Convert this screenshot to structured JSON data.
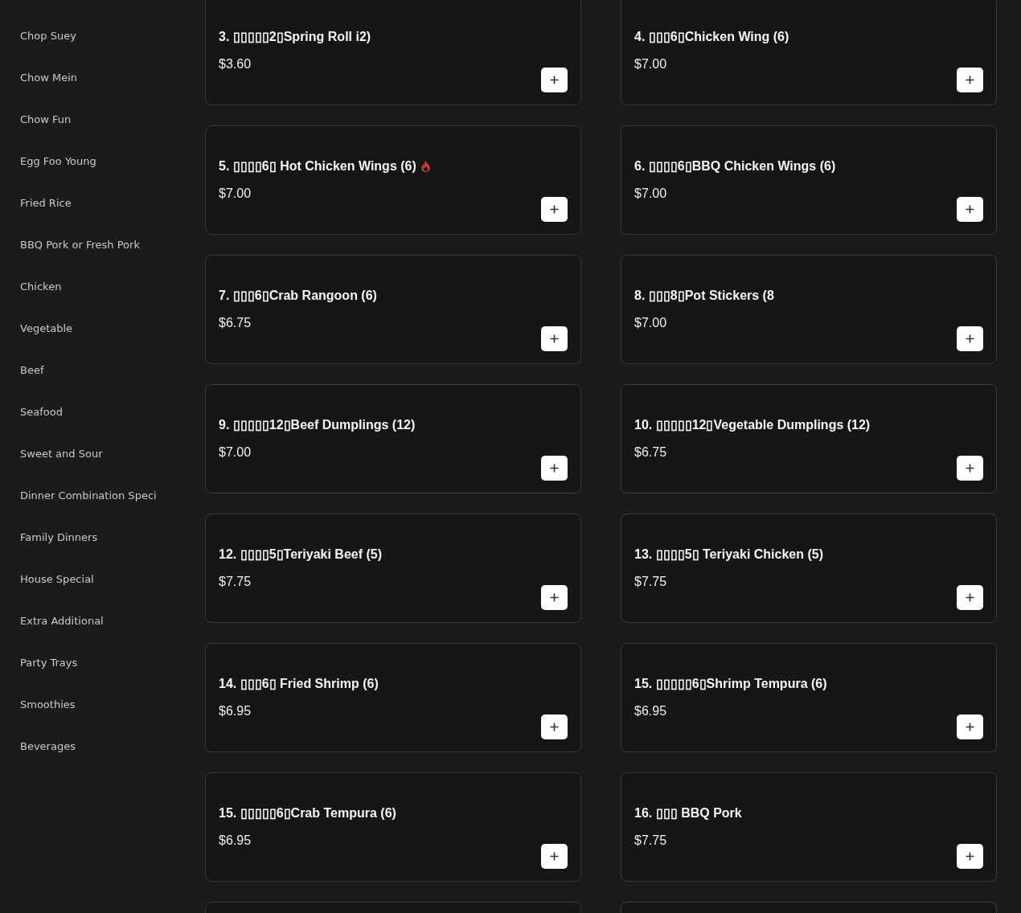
{
  "sidebar": {
    "categories": [
      "Chop Suey",
      "Chow Mein",
      "Chow Fun",
      "Egg Foo Young",
      "Fried Rice",
      "BBQ Pork or Fresh Pork",
      "Chicken",
      "Vegetable",
      "Beef",
      "Seafood",
      "Sweet and Sour",
      "Dinner Combination Speci",
      "Family Dinners",
      "House Special",
      "Extra Additional",
      "Party Trays",
      "Smoothies",
      "Beverages"
    ]
  },
  "menu": {
    "items": [
      {
        "kind": "dish",
        "name": "3. ▯▯▯▯▯2▯Spring Roll i2)",
        "price": "$3.60",
        "spicy": false
      },
      {
        "kind": "dish",
        "name": "4. ▯▯▯6▯Chicken Wing (6)",
        "price": "$7.00",
        "spicy": false
      },
      {
        "kind": "dish",
        "name": "5. ▯▯▯▯6▯ Hot Chicken Wings (6)",
        "price": "$7.00",
        "spicy": true
      },
      {
        "kind": "dish",
        "name": "6. ▯▯▯▯6▯BBQ Chicken Wings (6)",
        "price": "$7.00",
        "spicy": false
      },
      {
        "kind": "dish",
        "name": "7. ▯▯▯6▯Crab Rangoon (6)",
        "price": "$6.75",
        "spicy": false
      },
      {
        "kind": "dish",
        "name": "8. ▯▯▯8▯Pot Stickers (8",
        "price": "$7.00",
        "spicy": false
      },
      {
        "kind": "dish",
        "name": "9. ▯▯▯▯▯12▯Beef Dumplings (12)",
        "price": "$7.00",
        "spicy": false
      },
      {
        "kind": "dish",
        "name": "10. ▯▯▯▯▯12▯Vegetable Dumplings (12)",
        "price": "$6.75",
        "spicy": false
      },
      {
        "kind": "dish",
        "name": "12. ▯▯▯▯5▯Teriyaki Beef (5)",
        "price": "$7.75",
        "spicy": false
      },
      {
        "kind": "dish",
        "name": "13. ▯▯▯▯5▯ Teriyaki Chicken (5)",
        "price": "$7.75",
        "spicy": false
      },
      {
        "kind": "dish",
        "name": "14. ▯▯▯6▯ Fried Shrimp (6)",
        "price": "$6.95",
        "spicy": false
      },
      {
        "kind": "dish",
        "name": "15. ▯▯▯▯▯6▯Shrimp Tempura (6)",
        "price": "$6.95",
        "spicy": false
      },
      {
        "kind": "dish",
        "name": "15. ▯▯▯▯▯6▯Crab Tempura (6)",
        "price": "$6.95",
        "spicy": false
      },
      {
        "kind": "dish",
        "name": "16. ▯▯▯ BBQ Pork",
        "price": "$7.75",
        "spicy": false
      },
      {
        "kind": "cut-off"
      },
      {
        "kind": "cut-off"
      }
    ]
  }
}
